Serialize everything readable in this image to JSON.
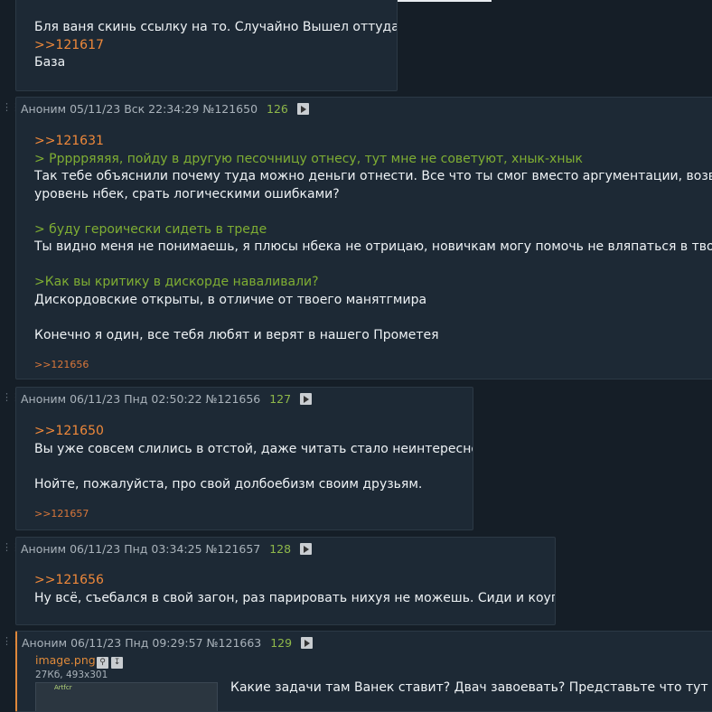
{
  "posts": [
    {
      "lines": [
        {
          "type": "text",
          "text": "Бля ваня скинь ссылку на то. Случайно Вышел оттуда."
        },
        {
          "type": "link",
          "text": ">>121617"
        },
        {
          "type": "text",
          "text": "База"
        }
      ]
    },
    {
      "author": "Аноним",
      "date": "05/11/23 Вск 22:34:29",
      "id": "№121650",
      "index": "126",
      "lines": [
        {
          "type": "link",
          "text": ">>121631"
        },
        {
          "type": "quote",
          "text": "> Ррррряяяя, пойду в другую песочницу отнесу, тут мне не советуют, хнык-хнык"
        },
        {
          "type": "text",
          "text": "Так тебе объяснили почему туда можно деньги отнести. Все что ты смог вместо аргументации, возвести м"
        },
        {
          "type": "text",
          "text": "уровень нбек, срать логическими ошибками?"
        },
        {
          "type": "blank",
          "text": ""
        },
        {
          "type": "quote",
          "text": "> буду героически сидеть в треде"
        },
        {
          "type": "text",
          "text": "Ты видно меня не понимаешь, я плюсы нбека не отрицаю, новичкам могу помочь не вляпаться в твоё дерьм"
        },
        {
          "type": "blank",
          "text": ""
        },
        {
          "type": "quote",
          "text": ">Как вы критику в дискорде наваливали?"
        },
        {
          "type": "text",
          "text": "Дискордовские открыты, в отличие от твоего манятгмира"
        },
        {
          "type": "blank",
          "text": ""
        },
        {
          "type": "text",
          "text": "Конечно я один, все тебя любят и верят в нашего Прометея"
        }
      ],
      "replies": ">>121656"
    },
    {
      "author": "Аноним",
      "date": "06/11/23 Пнд 02:50:22",
      "id": "№121656",
      "index": "127",
      "lines": [
        {
          "type": "link",
          "text": ">>121650"
        },
        {
          "type": "text",
          "text": "Вы уже совсем слились в отстой, даже читать стало неинтересно."
        },
        {
          "type": "blank",
          "text": ""
        },
        {
          "type": "text",
          "text": "Нойте, пожалуйста, про свой долбоебизм своим друзьям."
        }
      ],
      "replies": ">>121657"
    },
    {
      "author": "Аноним",
      "date": "06/11/23 Пнд 03:34:25",
      "id": "№121657",
      "index": "128",
      "lines": [
        {
          "type": "link",
          "text": ">>121656"
        },
        {
          "type": "text",
          "text": "Ну всё, съебался в свой загон, раз парировать нихуя не можешь. Сиди и коупи"
        }
      ]
    },
    {
      "author": "Аноним",
      "date": "06/11/23 Пнд 09:29:57",
      "id": "№121663",
      "index": "129",
      "file": {
        "name": "image.png",
        "meta": "27Кб, 493x301",
        "thumb_text": "Artfcr"
      },
      "lines": [
        {
          "type": "text",
          "text": "Какие задачи там Ванек ставит? Двач завоевать? Представьте что тут будет,"
        }
      ]
    }
  ],
  "colors": {
    "link": "#f0893a",
    "quote": "#7fae33",
    "post_bg": "#1d2935",
    "page_bg": "#151e27",
    "num": "#8fb84a",
    "accent_border": "#e0883a"
  }
}
